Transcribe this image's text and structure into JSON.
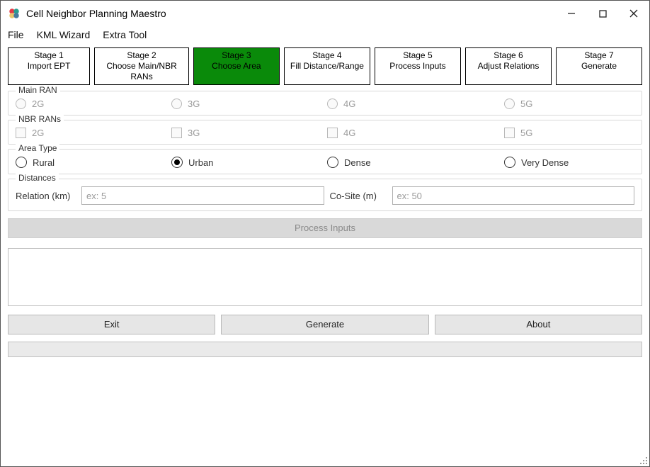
{
  "window": {
    "title": "Cell Neighbor Planning Maestro"
  },
  "menu": {
    "file": "File",
    "kml": "KML Wizard",
    "extra": "Extra Tool"
  },
  "stages": [
    {
      "line1": "Stage 1",
      "line2": "Import EPT",
      "active": false
    },
    {
      "line1": "Stage 2",
      "line2": "Choose Main/NBR RANs",
      "active": false
    },
    {
      "line1": "Stage 3",
      "line2": "Choose Area",
      "active": true
    },
    {
      "line1": "Stage 4",
      "line2": "Fill Distance/Range",
      "active": false
    },
    {
      "line1": "Stage 5",
      "line2": "Process Inputs",
      "active": false
    },
    {
      "line1": "Stage 6",
      "line2": "Adjust Relations",
      "active": false
    },
    {
      "line1": "Stage 7",
      "line2": "Generate",
      "active": false
    }
  ],
  "main_ran": {
    "legend": "Main RAN",
    "opts": [
      "2G",
      "3G",
      "4G",
      "5G"
    ]
  },
  "nbr_rans": {
    "legend": "NBR RANs",
    "opts": [
      "2G",
      "3G",
      "4G",
      "5G"
    ]
  },
  "area_type": {
    "legend": "Area Type",
    "opts": [
      "Rural",
      "Urban",
      "Dense",
      "Very Dense"
    ],
    "selected": "Urban"
  },
  "distances": {
    "legend": "Distances",
    "relation_label": "Relation (km)",
    "relation_ph": "ex: 5",
    "cosite_label": "Co-Site (m)",
    "cosite_ph": "ex: 50"
  },
  "buttons": {
    "process": "Process Inputs",
    "exit": "Exit",
    "generate": "Generate",
    "about": "About"
  }
}
